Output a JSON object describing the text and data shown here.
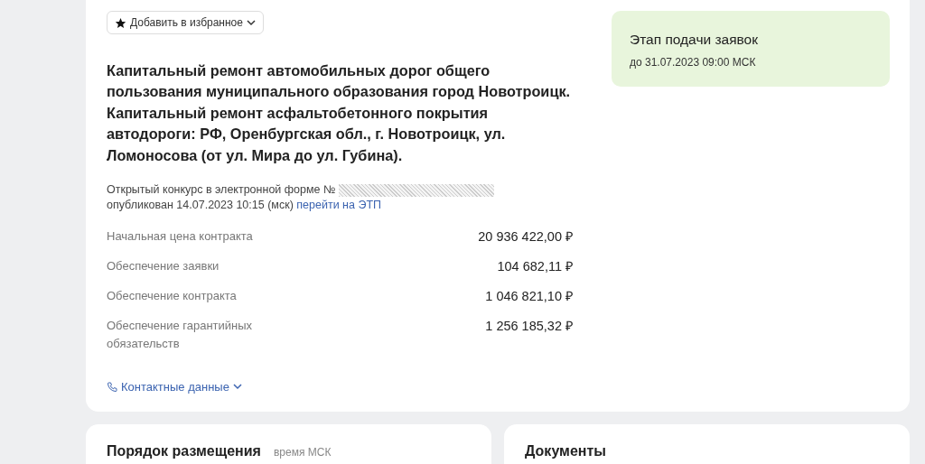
{
  "favorite_button": {
    "label": "Добавить в избранное"
  },
  "title": "Капитальный ремонт автомобильных дорог общего пользования муниципального образования город Новотроицк. Капитальный ремонт асфальтобетонного покрытия автодороги: РФ, Оренбургская обл., г. Новотроицк, ул. Ломоносова (от ул. Мира до ул. Губина).",
  "procedure": {
    "type_text": "Открытый конкурс в электронной форме №",
    "published": "опубликован 14.07.2023 10:15 (мск)",
    "link": "перейти на ЭТП"
  },
  "prices": [
    {
      "label": "Начальная цена контракта",
      "value": "20 936 422,00 ₽"
    },
    {
      "label": "Обеспечение заявки",
      "value": "104 682,11 ₽"
    },
    {
      "label": "Обеспечение контракта",
      "value": "1 046 821,10 ₽"
    },
    {
      "label": "Обеспечение гарантийных обязательств",
      "value": "1 256 185,32 ₽"
    }
  ],
  "contacts": {
    "label": "Контактные данные",
    "expanded": false
  },
  "stage": {
    "title": "Этап подачи заявок",
    "deadline": "до 31.07.2023 09:00 МСК"
  },
  "sections": [
    {
      "title": "Порядок размещения",
      "note": "время МСК"
    },
    {
      "title": "Документы"
    }
  ]
}
